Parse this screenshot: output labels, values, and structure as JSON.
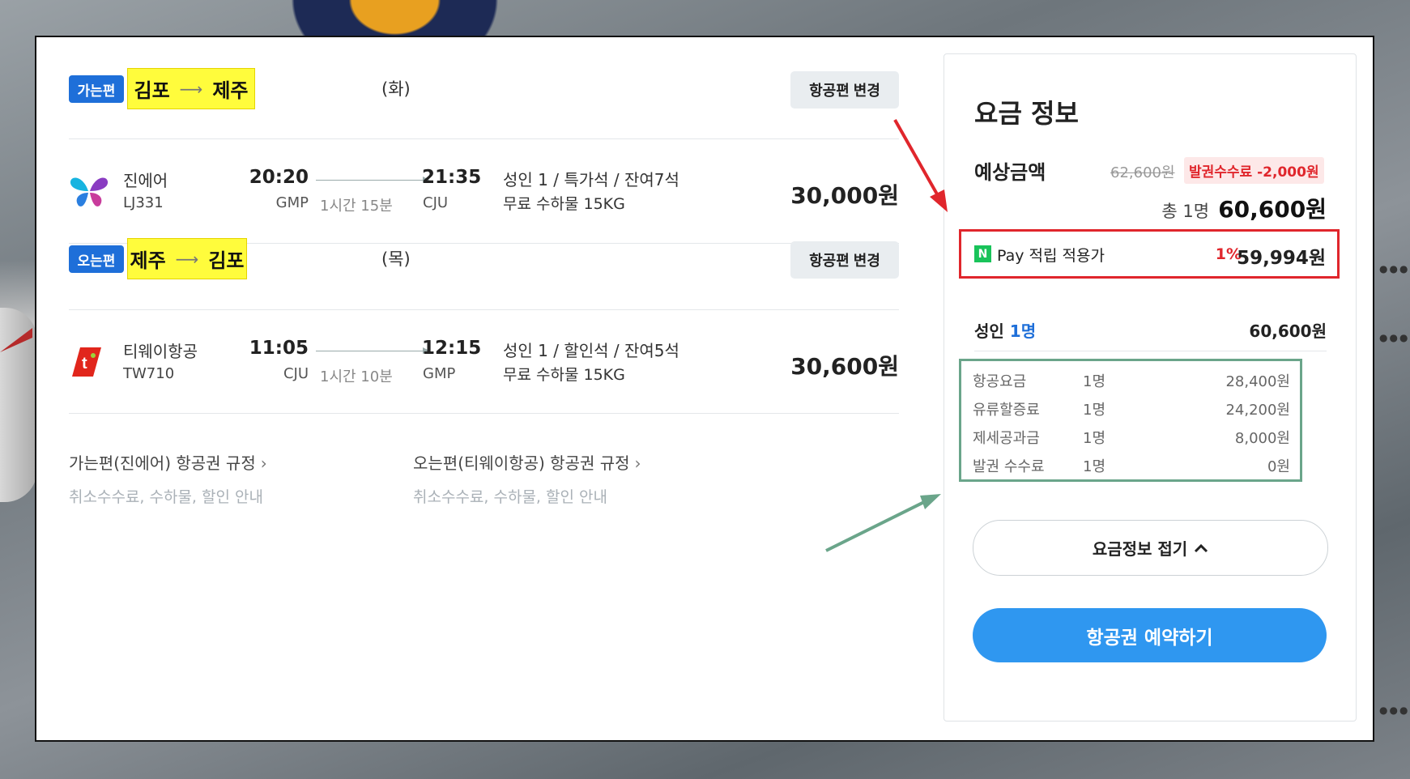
{
  "outbound": {
    "badge": "가는편",
    "from": "김포",
    "to": "제주",
    "day": "(화)",
    "change_label": "항공편 변경",
    "airline": "진에어",
    "flight_no": "LJ331",
    "dep_time": "20:20",
    "dep_airport": "GMP",
    "duration": "1시간 15분",
    "arr_time": "21:35",
    "arr_airport": "CJU",
    "seat_info": "성인 1 / 특가석 / 잔여7석",
    "baggage": "무료 수하물 15KG",
    "price": "30,000원"
  },
  "inbound": {
    "badge": "오는편",
    "from": "제주",
    "to": "김포",
    "day": "(목)",
    "change_label": "항공편 변경",
    "airline": "티웨이항공",
    "flight_no": "TW710",
    "dep_time": "11:05",
    "dep_airport": "CJU",
    "duration": "1시간 10분",
    "arr_time": "12:15",
    "arr_airport": "GMP",
    "seat_info": "성인 1 / 할인석 / 잔여5석",
    "baggage": "무료 수하물 15KG",
    "price": "30,600원"
  },
  "rules": [
    {
      "title": "가는편(진에어) 항공권 규정",
      "chevron": "›",
      "sub": "취소수수료, 수하물, 할인 안내"
    },
    {
      "title": "오는편(티웨이항공) 항공권 규정",
      "chevron": "›",
      "sub": "취소수수료, 수하물, 할인 안내"
    }
  ],
  "fare": {
    "title": "요금 정보",
    "est_label": "예상금액",
    "original_price": "62,600원",
    "discount_label": "발권수수료 -2,000원",
    "total_label": "총 1명",
    "total_amount": "60,600원",
    "npay_badge": "N",
    "npay_text": "Pay 적립 적용가",
    "npay_pct": "1%",
    "npay_amount": "59,994원",
    "adult_label": "성인",
    "adult_count": "1명",
    "adult_total": "60,600원",
    "breakdown": [
      {
        "label": "항공요금",
        "count": "1명",
        "amount": "28,400원"
      },
      {
        "label": "유류할증료",
        "count": "1명",
        "amount": "24,200원"
      },
      {
        "label": "제세공과금",
        "count": "1명",
        "amount": "8,000원"
      },
      {
        "label": "발권 수수료",
        "count": "1명",
        "amount": "0원"
      }
    ],
    "collapse_label": "요금정보 접기",
    "book_label": "항공권 예약하기"
  },
  "colors": {
    "accent_blue": "#1e6fd9",
    "book_button": "#2f97f0",
    "highlight_yellow": "#fffc3c",
    "annotation_red": "#e0262c",
    "annotation_green": "#6aa58a",
    "npay_green": "#19c35a"
  },
  "icons": {
    "outbound_logo": "jinair-butterfly-logo",
    "inbound_logo": "tway-logo",
    "collapse": "chevron-up-icon"
  }
}
